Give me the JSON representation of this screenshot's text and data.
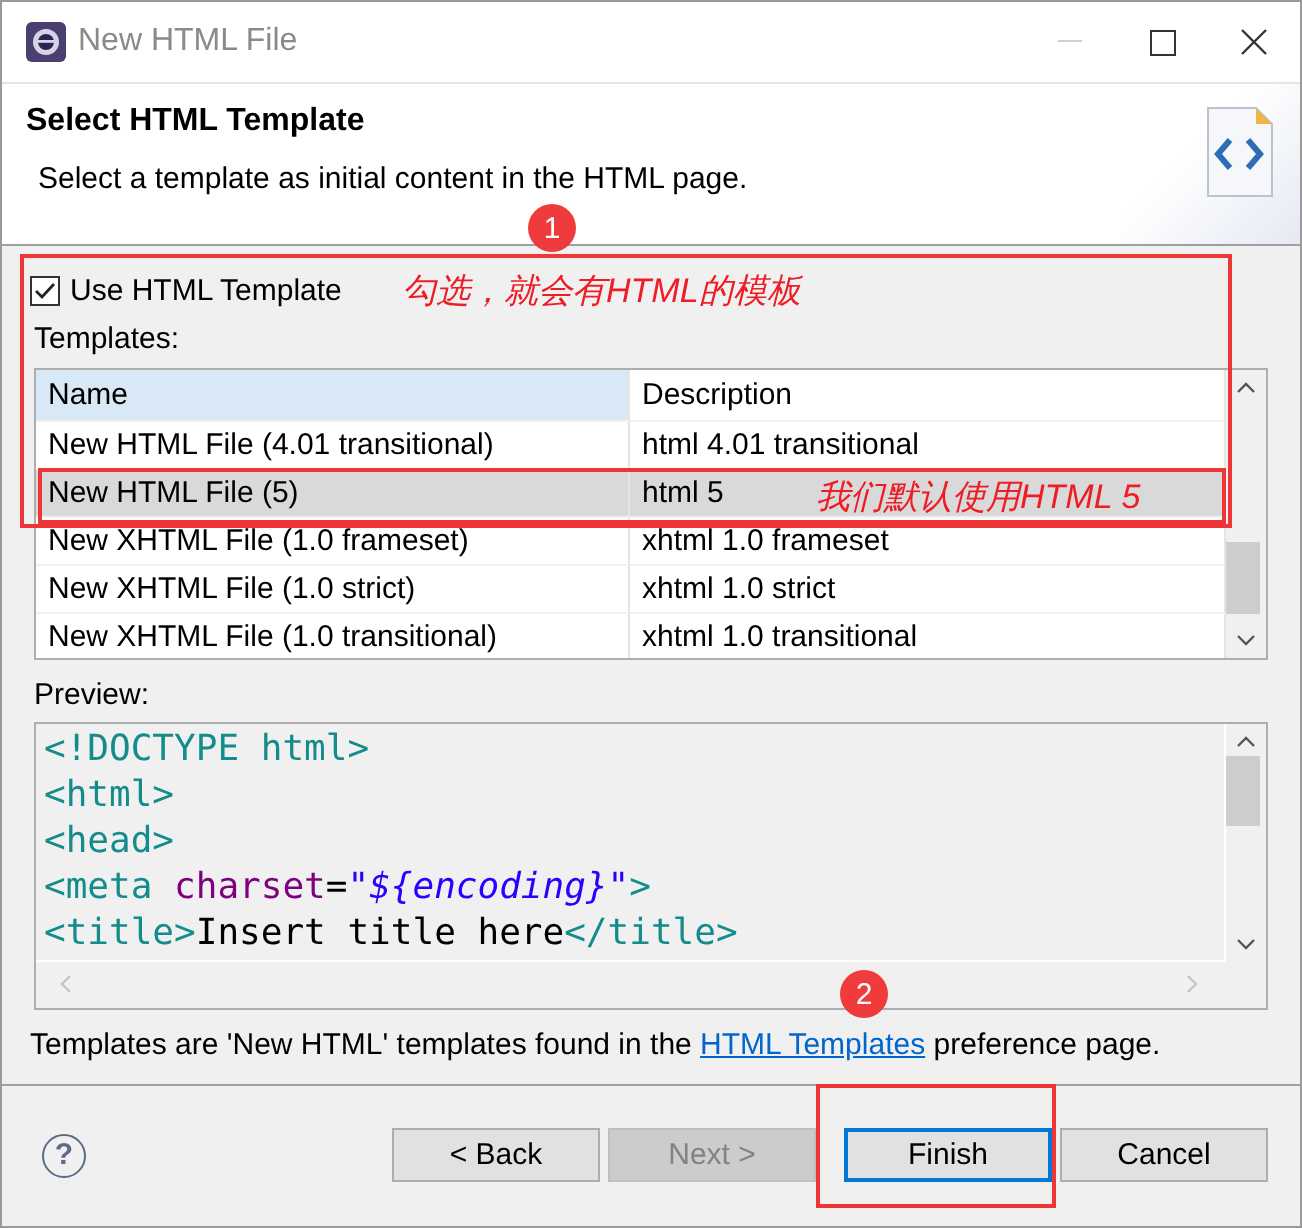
{
  "window": {
    "title": "New HTML File"
  },
  "header": {
    "title": "Select HTML Template",
    "description": "Select a template as initial content in the HTML page."
  },
  "use_template": {
    "label": "Use HTML Template",
    "checked": true
  },
  "templates_label": "Templates:",
  "table": {
    "columns": [
      "Name",
      "Description"
    ],
    "rows": [
      {
        "name": "New HTML File (4.01 transitional)",
        "description": "html 4.01 transitional",
        "selected": false
      },
      {
        "name": "New HTML File (5)",
        "description": "html 5",
        "selected": true
      },
      {
        "name": "New XHTML File (1.0 frameset)",
        "description": "xhtml 1.0 frameset",
        "selected": false
      },
      {
        "name": "New XHTML File (1.0 strict)",
        "description": "xhtml 1.0 strict",
        "selected": false
      },
      {
        "name": "New XHTML File (1.0 transitional)",
        "description": "xhtml 1.0 transitional",
        "selected": false
      }
    ]
  },
  "preview": {
    "label": "Preview:",
    "lines": [
      [
        {
          "kind": "tag",
          "text": "<!DOCTYPE html>"
        }
      ],
      [
        {
          "kind": "tag",
          "text": "<html>"
        }
      ],
      [
        {
          "kind": "tag",
          "text": "<head>"
        }
      ],
      [
        {
          "kind": "tag",
          "text": "<meta "
        },
        {
          "kind": "attr",
          "text": "charset"
        },
        {
          "kind": "plain",
          "text": "="
        },
        {
          "kind": "string",
          "text": "\"${encoding}\""
        },
        {
          "kind": "tag",
          "text": ">"
        }
      ],
      [
        {
          "kind": "tag",
          "text": "<title>"
        },
        {
          "kind": "plain",
          "text": "Insert title here"
        },
        {
          "kind": "tag",
          "text": "</title>"
        }
      ]
    ]
  },
  "footer_note": {
    "before": "Templates are 'New HTML' templates found in the ",
    "link": "HTML Templates",
    "after": " preference page."
  },
  "help": "?",
  "buttons": [
    {
      "label": "< Back",
      "disabled": false,
      "default": false
    },
    {
      "label": "Next >",
      "disabled": true,
      "default": false
    },
    {
      "label": "Finish",
      "disabled": false,
      "default": true
    },
    {
      "label": "Cancel",
      "disabled": false,
      "default": false
    }
  ],
  "annotations": [
    {
      "kind": "badge",
      "text": "1"
    },
    {
      "kind": "note",
      "text": "勾选，就会有HTML的模板"
    },
    {
      "kind": "note",
      "text": "我们默认使用HTML 5"
    },
    {
      "kind": "badge",
      "text": "2"
    }
  ]
}
